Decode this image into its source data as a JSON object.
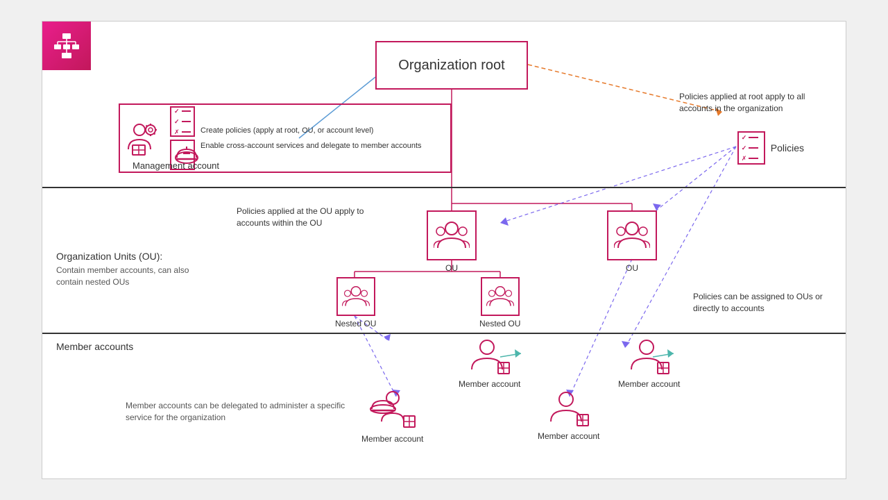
{
  "logo": {
    "alt": "AWS Organizations Icon"
  },
  "sections": {
    "root": {
      "title": "Organization root",
      "annotation": "Policies applied at root apply to all\naccounts in the organization"
    },
    "ou": {
      "label": "Organization Units (OU):",
      "sublabel": "Contain member accounts, can also\ncontain nested OUs",
      "annotation_ou": "Policies applied at the OU apply to\naccounts within the OU",
      "annotation_policy": "Policies can be assigned to\nOUs or directly to accounts",
      "ou1_label": "OU",
      "ou2_label": "OU",
      "nested_ou1_label": "Nested OU",
      "nested_ou2_label": "Nested OU"
    },
    "member": {
      "label": "Member accounts",
      "sublabel": "Member accounts can be delegated to administer\na specific service for the organization",
      "account1_label": "Member account",
      "account2_label": "Member account",
      "account3_label": "Member account",
      "account4_label": "Member account"
    }
  },
  "mgmt": {
    "label": "Management account",
    "text1": "Create policies (apply at root, OU,\nor account level)",
    "text2": "Enable cross-account services\nand delegate to member accounts"
  },
  "policies": {
    "label": "Policies"
  }
}
